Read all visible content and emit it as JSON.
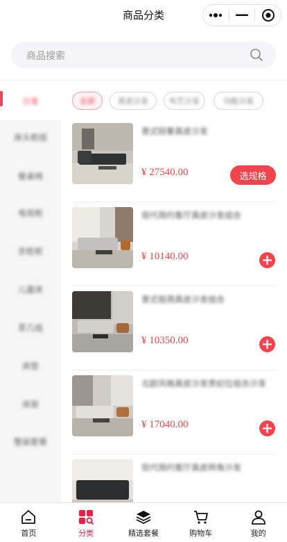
{
  "header": {
    "title": "商品分类",
    "capsule": {
      "more_icon": "more-dots-icon",
      "minimize_icon": "minimize-icon",
      "close_icon": "target-close-icon"
    }
  },
  "search": {
    "placeholder": "商品搜索",
    "icon": "search-icon"
  },
  "sidebar": {
    "active_index": 0,
    "accent": "#e94a5e",
    "items": [
      {
        "label": "沙发"
      },
      {
        "label": "床头柜组"
      },
      {
        "label": "餐桌椅"
      },
      {
        "label": "电视柜"
      },
      {
        "label": "衣柜柜"
      },
      {
        "label": "儿童床"
      },
      {
        "label": "茶几组"
      },
      {
        "label": "床垫"
      },
      {
        "label": "床架"
      },
      {
        "label": "整装套餐"
      }
    ]
  },
  "chips": [
    {
      "label": "全部"
    },
    {
      "label": "真皮沙发"
    },
    {
      "label": "布艺沙发"
    },
    {
      "label": "功能沙发"
    }
  ],
  "products": [
    {
      "name": "意式轻奢真皮沙发",
      "price": "¥ 27540.00",
      "action": "选规格"
    },
    {
      "name": "现代简约客厅真皮沙发组合",
      "price": "¥ 10140.00",
      "action": "add"
    },
    {
      "name": "意式极简真皮沙发组合",
      "price": "¥ 10350.00",
      "action": "add"
    },
    {
      "name": "北欧风格真皮沙发贵妃位组合沙发",
      "price": "¥ 17040.00",
      "action": "add"
    },
    {
      "name": "现代简约客厅真皮转角沙发",
      "price": "",
      "action": ""
    }
  ],
  "tabbar": {
    "active_index": 1,
    "accent": "#e8234a",
    "items": [
      {
        "label": "首页",
        "icon": "home-icon"
      },
      {
        "label": "分类",
        "icon": "category-icon"
      },
      {
        "label": "精选套餐",
        "icon": "layers-icon"
      },
      {
        "label": "购物车",
        "icon": "cart-icon"
      },
      {
        "label": "我的",
        "icon": "user-icon"
      }
    ]
  },
  "colors": {
    "price": "#e64a4a",
    "button": "#f2444c",
    "sidebar_bg": "#f6f6f6"
  }
}
